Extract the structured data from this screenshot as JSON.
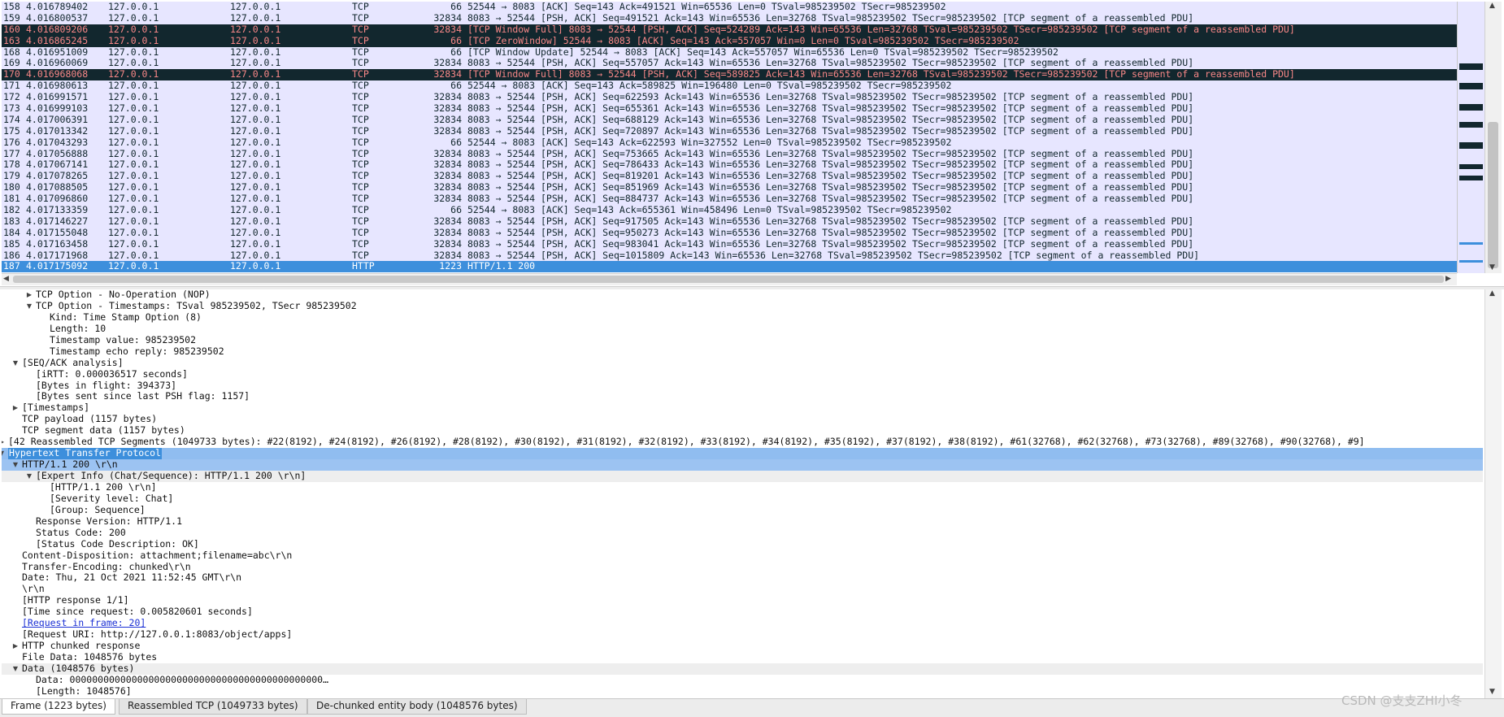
{
  "packet_list": {
    "rows": [
      {
        "no": "158",
        "time": "4.016789402",
        "src": "127.0.0.1",
        "dst": "127.0.0.1",
        "proto": "TCP",
        "len": "66",
        "info": "52544 → 8083 [ACK] Seq=143 Ack=491521 Win=65536 Len=0 TSval=985239502 TSecr=985239502",
        "style": "normal"
      },
      {
        "no": "159",
        "time": "4.016800537",
        "src": "127.0.0.1",
        "dst": "127.0.0.1",
        "proto": "TCP",
        "len": "32834",
        "info": "8083 → 52544 [PSH, ACK] Seq=491521 Ack=143 Win=65536 Len=32768 TSval=985239502 TSecr=985239502 [TCP segment of a reassembled PDU]",
        "style": "normal"
      },
      {
        "no": "160",
        "time": "4.016809206",
        "src": "127.0.0.1",
        "dst": "127.0.0.1",
        "proto": "TCP",
        "len": "32834",
        "info": "[TCP Window Full] 8083 → 52544 [PSH, ACK] Seq=524289 Ack=143 Win=65536 Len=32768 TSval=985239502 TSecr=985239502 [TCP segment of a reassembled PDU]",
        "style": "bad"
      },
      {
        "no": "163",
        "time": "4.016865245",
        "src": "127.0.0.1",
        "dst": "127.0.0.1",
        "proto": "TCP",
        "len": "66",
        "info": "[TCP ZeroWindow] 52544 → 8083 [ACK] Seq=143 Ack=557057 Win=0 Len=0 TSval=985239502 TSecr=985239502",
        "style": "bad"
      },
      {
        "no": "168",
        "time": "4.016951009",
        "src": "127.0.0.1",
        "dst": "127.0.0.1",
        "proto": "TCP",
        "len": "66",
        "info": "[TCP Window Update] 52544 → 8083 [ACK] Seq=143 Ack=557057 Win=65536 Len=0 TSval=985239502 TSecr=985239502",
        "style": "normal"
      },
      {
        "no": "169",
        "time": "4.016960069",
        "src": "127.0.0.1",
        "dst": "127.0.0.1",
        "proto": "TCP",
        "len": "32834",
        "info": "8083 → 52544 [PSH, ACK] Seq=557057 Ack=143 Win=65536 Len=32768 TSval=985239502 TSecr=985239502 [TCP segment of a reassembled PDU]",
        "style": "normal"
      },
      {
        "no": "170",
        "time": "4.016968068",
        "src": "127.0.0.1",
        "dst": "127.0.0.1",
        "proto": "TCP",
        "len": "32834",
        "info": "[TCP Window Full] 8083 → 52544 [PSH, ACK] Seq=589825 Ack=143 Win=65536 Len=32768 TSval=985239502 TSecr=985239502 [TCP segment of a reassembled PDU]",
        "style": "bad"
      },
      {
        "no": "171",
        "time": "4.016980613",
        "src": "127.0.0.1",
        "dst": "127.0.0.1",
        "proto": "TCP",
        "len": "66",
        "info": "52544 → 8083 [ACK] Seq=143 Ack=589825 Win=196480 Len=0 TSval=985239502 TSecr=985239502",
        "style": "normal"
      },
      {
        "no": "172",
        "time": "4.016991571",
        "src": "127.0.0.1",
        "dst": "127.0.0.1",
        "proto": "TCP",
        "len": "32834",
        "info": "8083 → 52544 [PSH, ACK] Seq=622593 Ack=143 Win=65536 Len=32768 TSval=985239502 TSecr=985239502 [TCP segment of a reassembled PDU]",
        "style": "normal"
      },
      {
        "no": "173",
        "time": "4.016999103",
        "src": "127.0.0.1",
        "dst": "127.0.0.1",
        "proto": "TCP",
        "len": "32834",
        "info": "8083 → 52544 [PSH, ACK] Seq=655361 Ack=143 Win=65536 Len=32768 TSval=985239502 TSecr=985239502 [TCP segment of a reassembled PDU]",
        "style": "normal"
      },
      {
        "no": "174",
        "time": "4.017006391",
        "src": "127.0.0.1",
        "dst": "127.0.0.1",
        "proto": "TCP",
        "len": "32834",
        "info": "8083 → 52544 [PSH, ACK] Seq=688129 Ack=143 Win=65536 Len=32768 TSval=985239502 TSecr=985239502 [TCP segment of a reassembled PDU]",
        "style": "normal"
      },
      {
        "no": "175",
        "time": "4.017013342",
        "src": "127.0.0.1",
        "dst": "127.0.0.1",
        "proto": "TCP",
        "len": "32834",
        "info": "8083 → 52544 [PSH, ACK] Seq=720897 Ack=143 Win=65536 Len=32768 TSval=985239502 TSecr=985239502 [TCP segment of a reassembled PDU]",
        "style": "normal"
      },
      {
        "no": "176",
        "time": "4.017043293",
        "src": "127.0.0.1",
        "dst": "127.0.0.1",
        "proto": "TCP",
        "len": "66",
        "info": "52544 → 8083 [ACK] Seq=143 Ack=622593 Win=327552 Len=0 TSval=985239502 TSecr=985239502",
        "style": "normal"
      },
      {
        "no": "177",
        "time": "4.017056888",
        "src": "127.0.0.1",
        "dst": "127.0.0.1",
        "proto": "TCP",
        "len": "32834",
        "info": "8083 → 52544 [PSH, ACK] Seq=753665 Ack=143 Win=65536 Len=32768 TSval=985239502 TSecr=985239502 [TCP segment of a reassembled PDU]",
        "style": "normal"
      },
      {
        "no": "178",
        "time": "4.017067141",
        "src": "127.0.0.1",
        "dst": "127.0.0.1",
        "proto": "TCP",
        "len": "32834",
        "info": "8083 → 52544 [PSH, ACK] Seq=786433 Ack=143 Win=65536 Len=32768 TSval=985239502 TSecr=985239502 [TCP segment of a reassembled PDU]",
        "style": "normal"
      },
      {
        "no": "179",
        "time": "4.017078265",
        "src": "127.0.0.1",
        "dst": "127.0.0.1",
        "proto": "TCP",
        "len": "32834",
        "info": "8083 → 52544 [PSH, ACK] Seq=819201 Ack=143 Win=65536 Len=32768 TSval=985239502 TSecr=985239502 [TCP segment of a reassembled PDU]",
        "style": "normal"
      },
      {
        "no": "180",
        "time": "4.017088505",
        "src": "127.0.0.1",
        "dst": "127.0.0.1",
        "proto": "TCP",
        "len": "32834",
        "info": "8083 → 52544 [PSH, ACK] Seq=851969 Ack=143 Win=65536 Len=32768 TSval=985239502 TSecr=985239502 [TCP segment of a reassembled PDU]",
        "style": "normal"
      },
      {
        "no": "181",
        "time": "4.017096860",
        "src": "127.0.0.1",
        "dst": "127.0.0.1",
        "proto": "TCP",
        "len": "32834",
        "info": "8083 → 52544 [PSH, ACK] Seq=884737 Ack=143 Win=65536 Len=32768 TSval=985239502 TSecr=985239502 [TCP segment of a reassembled PDU]",
        "style": "normal"
      },
      {
        "no": "182",
        "time": "4.017133359",
        "src": "127.0.0.1",
        "dst": "127.0.0.1",
        "proto": "TCP",
        "len": "66",
        "info": "52544 → 8083 [ACK] Seq=143 Ack=655361 Win=458496 Len=0 TSval=985239502 TSecr=985239502",
        "style": "normal"
      },
      {
        "no": "183",
        "time": "4.017146227",
        "src": "127.0.0.1",
        "dst": "127.0.0.1",
        "proto": "TCP",
        "len": "32834",
        "info": "8083 → 52544 [PSH, ACK] Seq=917505 Ack=143 Win=65536 Len=32768 TSval=985239502 TSecr=985239502 [TCP segment of a reassembled PDU]",
        "style": "normal"
      },
      {
        "no": "184",
        "time": "4.017155048",
        "src": "127.0.0.1",
        "dst": "127.0.0.1",
        "proto": "TCP",
        "len": "32834",
        "info": "8083 → 52544 [PSH, ACK] Seq=950273 Ack=143 Win=65536 Len=32768 TSval=985239502 TSecr=985239502 [TCP segment of a reassembled PDU]",
        "style": "normal"
      },
      {
        "no": "185",
        "time": "4.017163458",
        "src": "127.0.0.1",
        "dst": "127.0.0.1",
        "proto": "TCP",
        "len": "32834",
        "info": "8083 → 52544 [PSH, ACK] Seq=983041 Ack=143 Win=65536 Len=32768 TSval=985239502 TSecr=985239502 [TCP segment of a reassembled PDU]",
        "style": "normal"
      },
      {
        "no": "186",
        "time": "4.017171968",
        "src": "127.0.0.1",
        "dst": "127.0.0.1",
        "proto": "TCP",
        "len": "32834",
        "info": "8083 → 52544 [PSH, ACK] Seq=1015809 Ack=143 Win=65536 Len=32768 TSval=985239502 TSecr=985239502 [TCP segment of a reassembled PDU]",
        "style": "normal"
      },
      {
        "no": "187",
        "time": "4.017175092",
        "src": "127.0.0.1",
        "dst": "127.0.0.1",
        "proto": "HTTP",
        "len": "1223",
        "info": "HTTP/1.1 200",
        "style": "selected"
      }
    ]
  },
  "details": {
    "rows": [
      {
        "level": 3,
        "toggle": "collapsed",
        "text": "TCP Option - No-Operation (NOP)"
      },
      {
        "level": 3,
        "toggle": "expanded",
        "text": "TCP Option - Timestamps: TSval 985239502, TSecr 985239502"
      },
      {
        "level": 4,
        "toggle": "none",
        "text": "Kind: Time Stamp Option (8)"
      },
      {
        "level": 4,
        "toggle": "none",
        "text": "Length: 10"
      },
      {
        "level": 4,
        "toggle": "none",
        "text": "Timestamp value: 985239502"
      },
      {
        "level": 4,
        "toggle": "none",
        "text": "Timestamp echo reply: 985239502"
      },
      {
        "level": 2,
        "toggle": "expanded",
        "text": "[SEQ/ACK analysis]"
      },
      {
        "level": 3,
        "toggle": "none",
        "text": "[iRTT: 0.000036517 seconds]"
      },
      {
        "level": 3,
        "toggle": "none",
        "text": "[Bytes in flight: 394373]"
      },
      {
        "level": 3,
        "toggle": "none",
        "text": "[Bytes sent since last PSH flag: 1157]"
      },
      {
        "level": 2,
        "toggle": "collapsed",
        "text": "[Timestamps]"
      },
      {
        "level": 2,
        "toggle": "none",
        "text": "TCP payload (1157 bytes)"
      },
      {
        "level": 2,
        "toggle": "none",
        "text": "TCP segment data (1157 bytes)"
      },
      {
        "level": 1,
        "toggle": "collapsed",
        "text": "[42 Reassembled TCP Segments (1049733 bytes): #22(8192), #24(8192), #26(8192), #28(8192), #30(8192), #31(8192), #32(8192), #33(8192), #34(8192), #35(8192), #37(8192), #38(8192), #61(32768), #62(32768), #73(32768), #89(32768), #90(32768), #9]"
      },
      {
        "level": 1,
        "toggle": "expanded",
        "text": "Hypertext Transfer Protocol",
        "style": "hl1"
      },
      {
        "level": 2,
        "toggle": "expanded",
        "text": "HTTP/1.1 200 \\r\\n",
        "style": "hl2"
      },
      {
        "level": 3,
        "toggle": "expanded",
        "text": "[Expert Info (Chat/Sequence): HTTP/1.1 200 \\r\\n]",
        "style": "hl3"
      },
      {
        "level": 4,
        "toggle": "none",
        "text": "[HTTP/1.1 200 \\r\\n]"
      },
      {
        "level": 4,
        "toggle": "none",
        "text": "[Severity level: Chat]"
      },
      {
        "level": 4,
        "toggle": "none",
        "text": "[Group: Sequence]"
      },
      {
        "level": 3,
        "toggle": "none",
        "text": "Response Version: HTTP/1.1"
      },
      {
        "level": 3,
        "toggle": "none",
        "text": "Status Code: 200"
      },
      {
        "level": 3,
        "toggle": "none",
        "text": "[Status Code Description: OK]"
      },
      {
        "level": 2,
        "toggle": "none",
        "text": "Content-Disposition: attachment;filename=abc\\r\\n"
      },
      {
        "level": 2,
        "toggle": "none",
        "text": "Transfer-Encoding: chunked\\r\\n"
      },
      {
        "level": 2,
        "toggle": "none",
        "text": "Date: Thu, 21 Oct 2021 11:52:45 GMT\\r\\n"
      },
      {
        "level": 2,
        "toggle": "none",
        "text": "\\r\\n"
      },
      {
        "level": 2,
        "toggle": "none",
        "text": "[HTTP response 1/1]"
      },
      {
        "level": 2,
        "toggle": "none",
        "text": "[Time since request: 0.005820601 seconds]"
      },
      {
        "level": 2,
        "toggle": "none",
        "text": "[Request in frame: 20]",
        "style": "link"
      },
      {
        "level": 2,
        "toggle": "none",
        "text": "[Request URI: http://127.0.0.1:8083/object/apps]"
      },
      {
        "level": 2,
        "toggle": "collapsed",
        "text": "HTTP chunked response"
      },
      {
        "level": 2,
        "toggle": "none",
        "text": "File Data: 1048576 bytes"
      },
      {
        "level": 2,
        "toggle": "expanded",
        "text": "Data (1048576 bytes)",
        "style": "hl3"
      },
      {
        "level": 3,
        "toggle": "none",
        "text": "Data: 000000000000000000000000000000000000000000000…"
      },
      {
        "level": 3,
        "toggle": "none",
        "text": "[Length: 1048576]"
      }
    ]
  },
  "tabs": [
    {
      "label": "Frame (1223 bytes)",
      "active": true
    },
    {
      "label": "Reassembled TCP (1049733 bytes)",
      "active": false
    },
    {
      "label": "De-chunked entity body (1048576 bytes)",
      "active": false
    }
  ],
  "watermark": "CSDN @支支ZHI小冬",
  "colors": {
    "normal_row_bg": "#e7e6ff",
    "normal_row_fg": "#12272e",
    "bad_row_bg": "#12272e",
    "bad_row_fg": "#f78787",
    "selected_row_bg": "#3d8fdc",
    "selected_row_fg": "#ffffff",
    "link": "#1a2fd4"
  },
  "icons": {
    "expanded": "triangle-down-icon",
    "collapsed": "triangle-right-icon",
    "scroll_up": "arrow-up-icon",
    "scroll_down": "arrow-down-icon",
    "scroll_left": "arrow-left-icon",
    "scroll_right": "arrow-right-icon"
  }
}
